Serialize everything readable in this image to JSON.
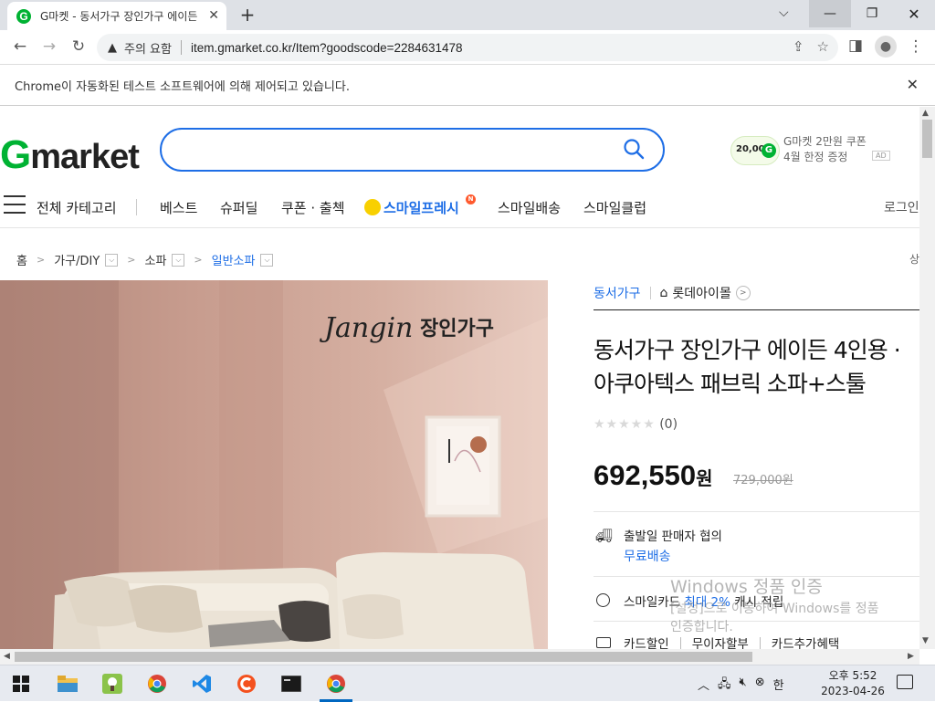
{
  "browser": {
    "tab_title": "G마켓 - 동서가구 장인가구 에이든 4인용 아쿠아텍스 패브릭 소파+스툴",
    "tab_favicon_letter": "G",
    "security_label": "주의 요함",
    "url": "item.gmarket.co.kr/Item?goodscode=2284631478",
    "infobar_text": "Chrome이 자동화된 테스트 소프트웨어에 의해 제어되고 있습니다."
  },
  "header": {
    "logo_g": "G",
    "logo_rest": "market",
    "search_value": "",
    "promo": {
      "coupon_amount": "20,000",
      "coupon_g": "G",
      "line1": "G마켓 2만원 쿠폰",
      "line2": "4월 한정 증정",
      "ad_label": "AD"
    }
  },
  "gnb": {
    "all_categories": "전체 카테고리",
    "items": [
      "베스트",
      "슈퍼딜",
      "쿠폰 · 출첵",
      "스마일프레시",
      "스마일배송",
      "스마일클럽"
    ],
    "new_badge": "N",
    "login": "로그인"
  },
  "breadcrumb": {
    "home": "홈",
    "level1": "가구/DIY",
    "level2": "소파",
    "level3": "일반소파",
    "right_text": "상"
  },
  "product": {
    "image_brand_script": "Jangin",
    "image_brand_text": "장인가구",
    "brand": "동서가구",
    "shop": "롯데아이몰",
    "title_line1": "동서가구 장인가구 에이든 4인용 ·",
    "title_line2": "아쿠아텍스 패브릭 소파+스툴",
    "stars": "★★★★★",
    "review_count": "(0)",
    "rating": 0,
    "price": "692,550",
    "price_unit": "원",
    "original_price": "729,000원",
    "shipping": {
      "label": "출발일 판매자 협의",
      "free": "무료배송"
    },
    "smile_card": {
      "prefix": "스마일카드",
      "highlight": "최대 2%",
      "suffix": "캐시 적립"
    },
    "card_benefits": [
      "카드할인",
      "무이자할부",
      "카드추가혜택"
    ]
  },
  "watermark": {
    "title": "Windows 정품 인증",
    "line1": "[설정]으로 이동하여 Windows를 정품",
    "line2": "인증합니다."
  },
  "taskbar": {
    "tray_ime": "한",
    "time": "오후 5:52",
    "date": "2023-04-26"
  },
  "colors": {
    "brand_green": "#00b233",
    "accent_blue": "#1e6ee6",
    "smile_yellow": "#f8d000",
    "badge_orange": "#ff5a2e"
  }
}
